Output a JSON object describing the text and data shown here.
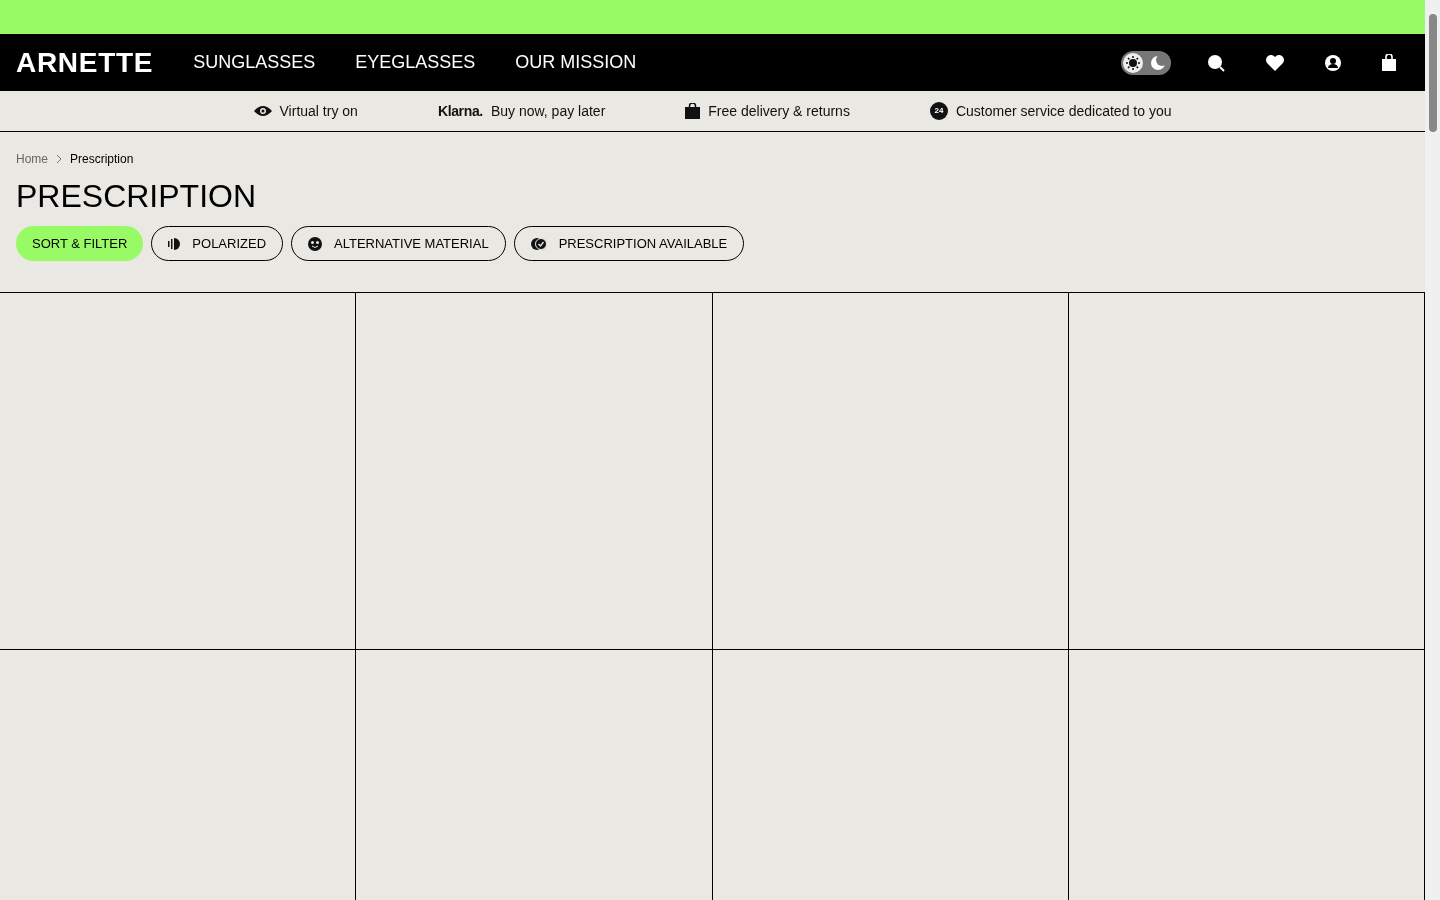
{
  "header": {
    "logo": "ARNETTE",
    "nav": [
      "SUNGLASSES",
      "EYEGLASSES",
      "OUR MISSION"
    ],
    "theme_toggle": {
      "dark": false
    }
  },
  "benefits": [
    {
      "kind": "eye",
      "text": "Virtual try on"
    },
    {
      "kind": "klarna",
      "brand": "Klarna.",
      "text": "Buy now, pay later"
    },
    {
      "kind": "bag",
      "text": "Free delivery & returns"
    },
    {
      "kind": "support",
      "badge": "24",
      "text": "Customer service dedicated to you"
    }
  ],
  "breadcrumb": [
    "Home",
    "Prescription"
  ],
  "title": "PRESCRIPTION",
  "filters": [
    {
      "kind": "primary",
      "label": "SORT & FILTER"
    },
    {
      "kind": "polarized",
      "label": "POLARIZED"
    },
    {
      "kind": "material",
      "label": "ALTERNATIVE MATERIAL"
    },
    {
      "kind": "prescription",
      "label": "PRESCRIPTION AVAILABLE"
    }
  ]
}
